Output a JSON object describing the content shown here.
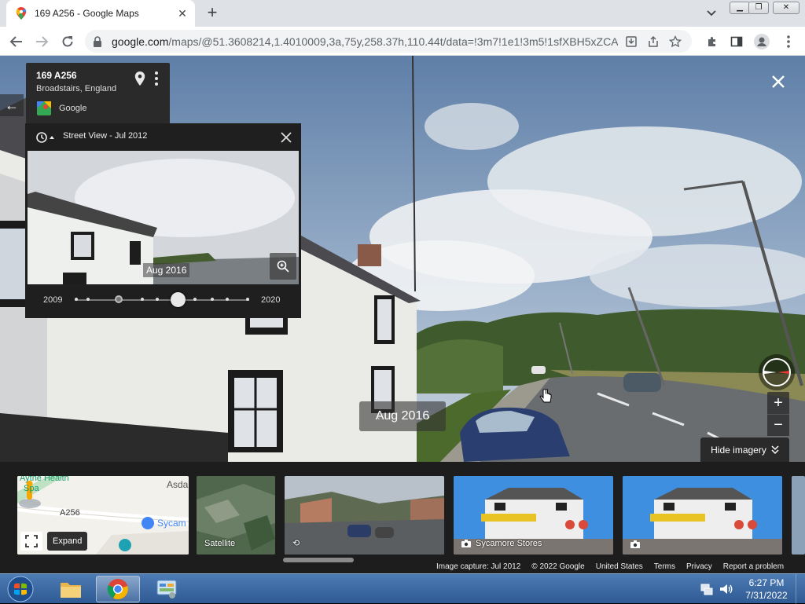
{
  "browser": {
    "tab_title": "169 A256 - Google Maps",
    "url_main": "google.com",
    "url_rest": "/maps/@51.3608214,1.4010009,3a,75y,258.37h,110.44t/data=!3m7!1e1!3m5!1sfXBH5xZCA..."
  },
  "place": {
    "title": "169 A256",
    "subtitle": "Broadstairs, England",
    "source": "Google"
  },
  "time_travel": {
    "title": "Street View - Jul 2012",
    "selected_date": "Aug 2016",
    "year_start": "2009",
    "year_end": "2020"
  },
  "streetview": {
    "date_chip": "Aug 2016",
    "hide_imagery_label": "Hide imagery",
    "zoom_in": "+",
    "zoom_out": "−"
  },
  "filmstrip": {
    "minimap_labels": [
      "A256",
      "Asda",
      "Sycam",
      "Spa",
      "Aytne Health"
    ],
    "expand_tooltip": "Expand",
    "satellite_label": "Satellite",
    "store1_label": "Sycamore Stores"
  },
  "footer": {
    "image_capture": "Image capture: Jul 2012",
    "copyright": "© 2022 Google",
    "country": "United States",
    "terms": "Terms",
    "privacy": "Privacy",
    "report": "Report a problem"
  },
  "taskbar": {
    "time": "6:27 PM",
    "date": "7/31/2022"
  }
}
